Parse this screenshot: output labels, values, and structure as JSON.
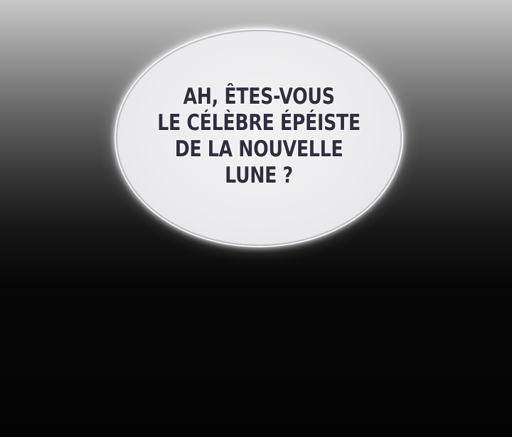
{
  "bubble": {
    "lines": [
      "AH, ÊTES-VOUS",
      "LE CÉLÈBRE ÉPÉISTE",
      "DE LA NOUVELLE",
      "LUNE ?"
    ]
  },
  "colors": {
    "bubble_fill": "#ececee",
    "bubble_border": "#bfc0c6",
    "text": "#2e2e3e",
    "background_top": "#c9c9c9",
    "background_bottom": "#030303"
  }
}
